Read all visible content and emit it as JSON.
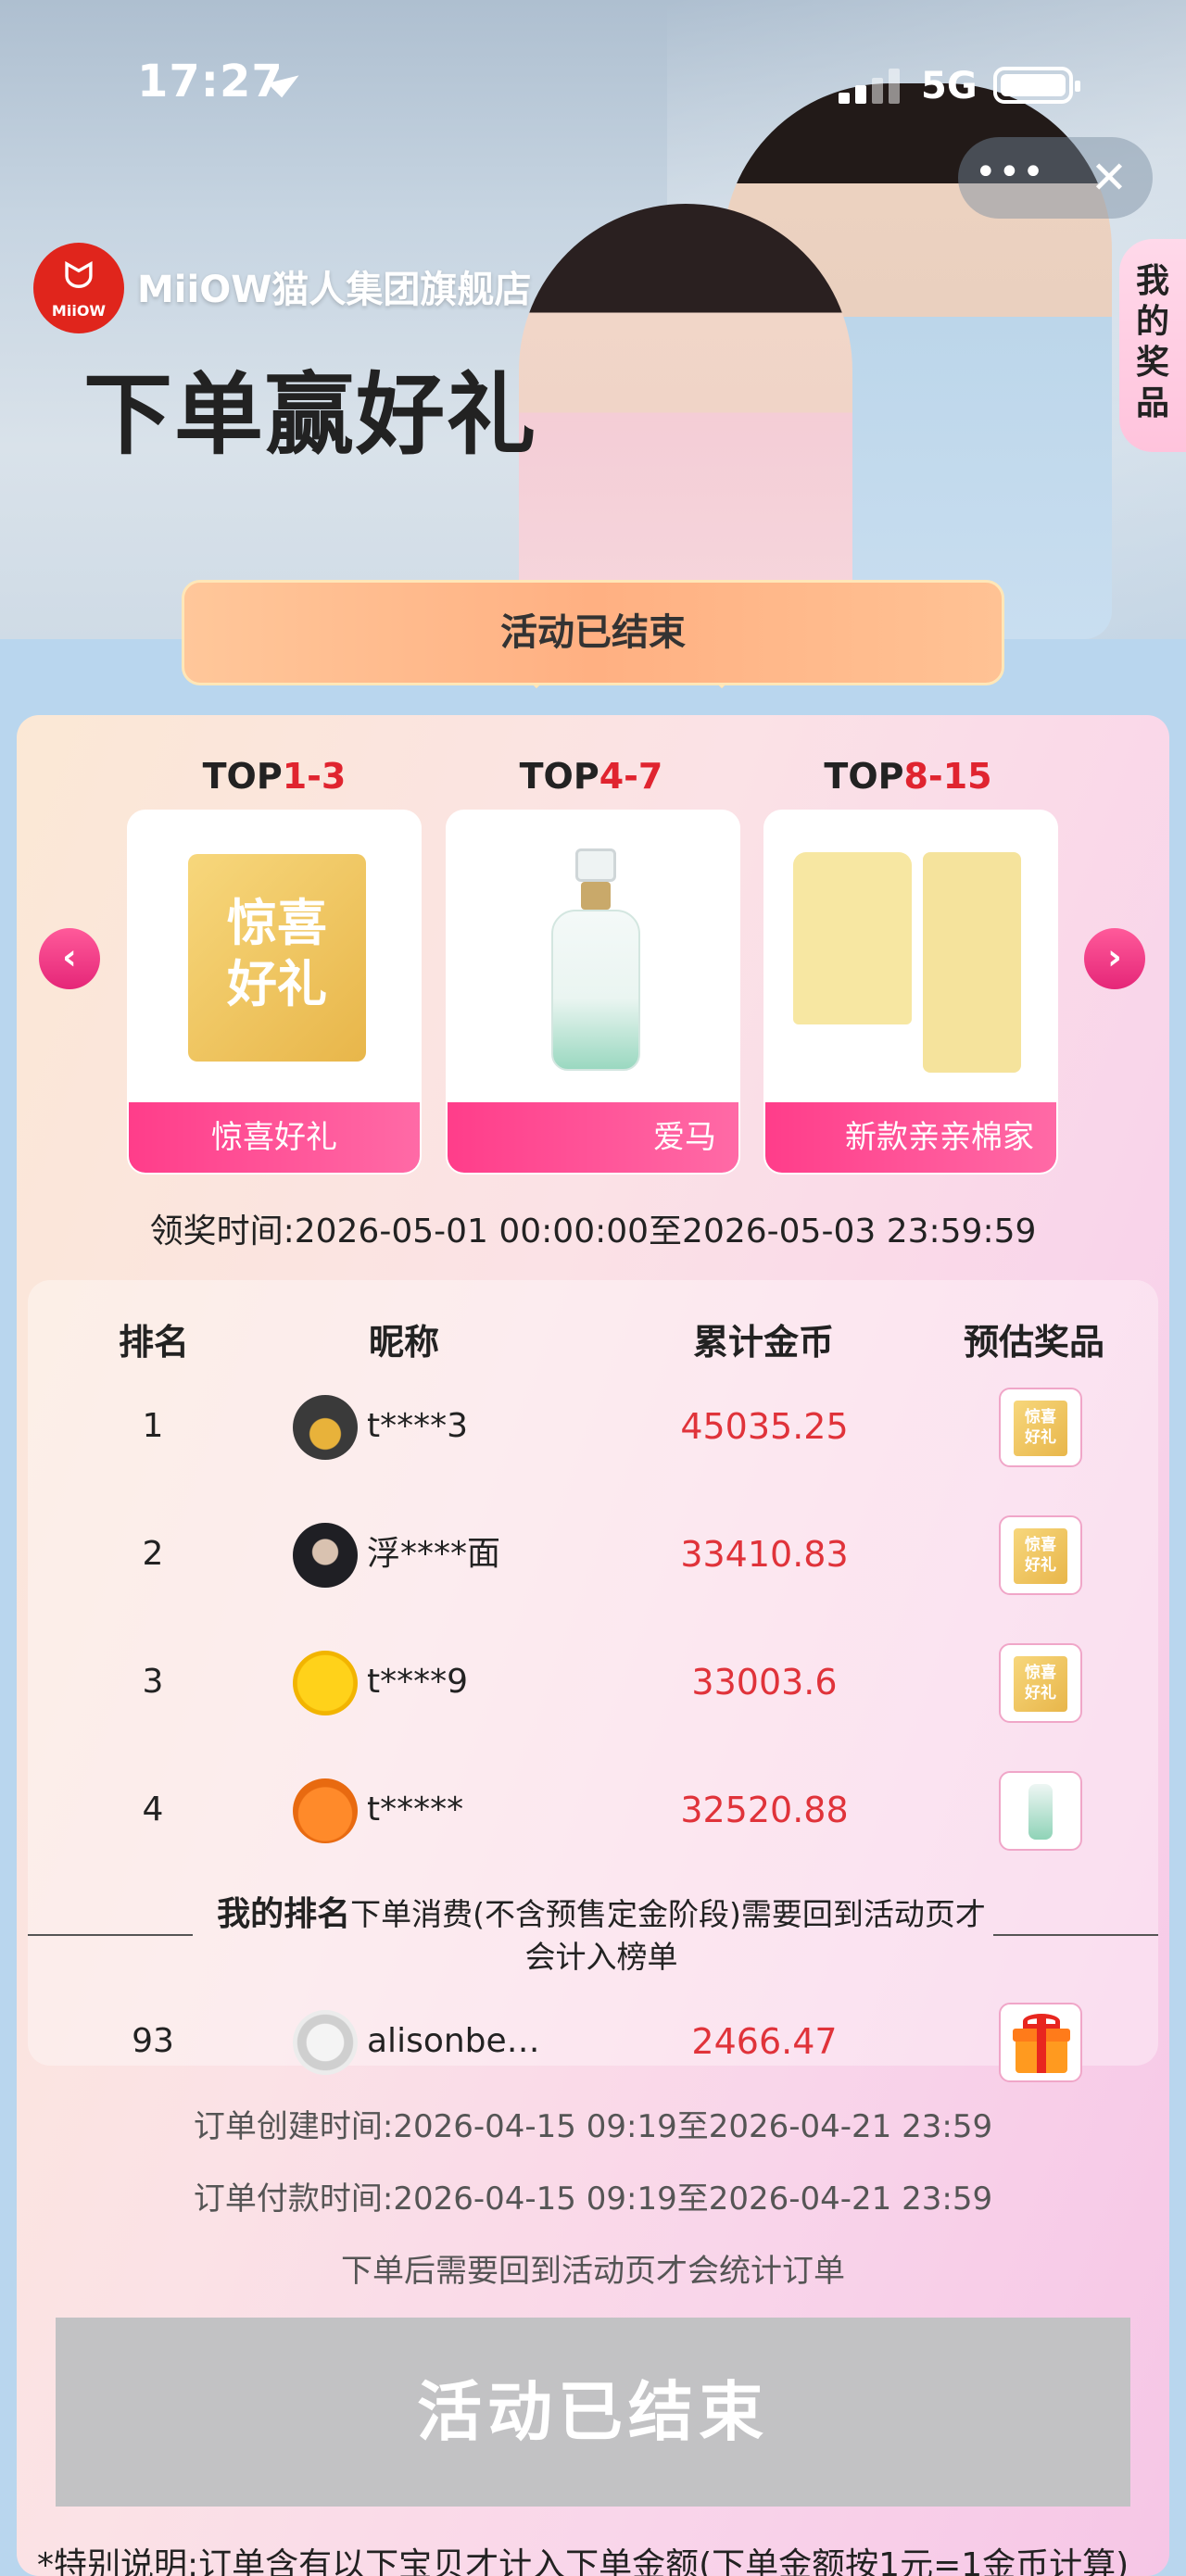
{
  "status": {
    "time": "17:27",
    "network": "5G"
  },
  "banner": {
    "shop_name": "MiiOW猫人集团旗舰店",
    "brand_logo_text": "MiiOW",
    "headline": "下单赢好礼",
    "my_prizes_tab": "我的奖品",
    "status_banner": "活动已结束"
  },
  "tiers": [
    {
      "prefix": "TOP",
      "range": "1-3",
      "prize_label": "惊喜好礼",
      "voucher_text": "惊喜好礼"
    },
    {
      "prefix": "TOP",
      "range": "4-7",
      "prize_label": "爱马"
    },
    {
      "prefix": "TOP",
      "range": "8-15",
      "prize_label": "新款亲亲棉家"
    }
  ],
  "claim_time": "领奖时间:2026-05-01 00:00:00至2026-05-03 23:59:59",
  "ranking": {
    "headers": {
      "rank": "排名",
      "nickname": "昵称",
      "coins": "累计金币",
      "prize": "预估奖品"
    },
    "rows": [
      {
        "rank": "1",
        "nickname": "t****3",
        "coins": "45035.25",
        "prize": "voucher",
        "voucher_text": "惊喜好礼"
      },
      {
        "rank": "2",
        "nickname": "浮****面",
        "coins": "33410.83",
        "prize": "voucher",
        "voucher_text": "惊喜好礼"
      },
      {
        "rank": "3",
        "nickname": "t****9",
        "coins": "33003.6",
        "prize": "voucher",
        "voucher_text": "惊喜好礼"
      },
      {
        "rank": "4",
        "nickname": "t*****",
        "coins": "32520.88",
        "prize": "perfume"
      }
    ],
    "my_rank_title": "我的排名",
    "my_rank_note": "下单消费(不含预售定金阶段)需要回到活动页才会计入榜单",
    "my_row": {
      "rank": "93",
      "nickname": "alisonbe…",
      "coins": "2466.47",
      "prize": "gift"
    }
  },
  "order_info": {
    "created": "订单创建时间:2026-04-15 09:19至2026-04-21 23:59",
    "paid": "订单付款时间:2026-04-15 09:19至2026-04-21 23:59",
    "note": "下单后需要回到活动页才会统计订单"
  },
  "action_button": "活动已结束",
  "special_note": "*特别说明:订单含有以下宝贝才计入下单金额(下单金额按1元=1金币计算)",
  "colors": {
    "accent_pink": "#ff3d8a",
    "coin_red": "#e0333a",
    "disabled_gray": "#c2c2c4",
    "brand_red": "#e0251c"
  }
}
